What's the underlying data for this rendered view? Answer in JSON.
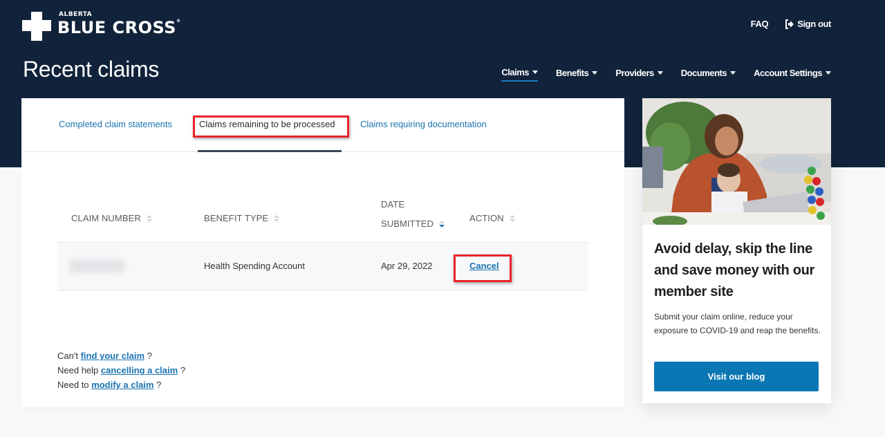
{
  "brand": {
    "name_small": "ALBERTA",
    "name_large": "BLUE CROSS",
    "trademark": "®"
  },
  "header": {
    "page_title": "Recent claims",
    "utility_nav": [
      {
        "label": "FAQ",
        "icon": null
      },
      {
        "label": "Sign out",
        "icon": "sign-out-icon"
      }
    ],
    "main_nav": [
      {
        "label": "Claims",
        "active": true
      },
      {
        "label": "Benefits",
        "active": false
      },
      {
        "label": "Providers",
        "active": false
      },
      {
        "label": "Documents",
        "active": false
      },
      {
        "label": "Account Settings",
        "active": false
      }
    ]
  },
  "tabs": [
    {
      "label": "Completed claim statements",
      "selected": false
    },
    {
      "label": "Claims remaining to be processed",
      "selected": true
    },
    {
      "label": "Claims requiring documentation",
      "selected": false
    }
  ],
  "table": {
    "columns": [
      {
        "label": "CLAIM NUMBER",
        "sort": "none"
      },
      {
        "label": "BENEFIT TYPE",
        "sort": "none"
      },
      {
        "label_line1": "DATE",
        "label_line2": "SUBMITTED",
        "sort": "descending"
      },
      {
        "label": "ACTION",
        "sort": "none"
      }
    ],
    "rows": [
      {
        "claim_number": "[redacted]",
        "benefit_type": "Health Spending Account",
        "date_submitted": "Apr 29, 2022",
        "action": "Cancel"
      }
    ]
  },
  "help_links": [
    {
      "prefix": "Can't",
      "link": "find your claim",
      "suffix": "?"
    },
    {
      "prefix": "Need help",
      "link": "cancelling a claim",
      "suffix": "?"
    },
    {
      "prefix": "Need to",
      "link": "modify a claim",
      "suffix": "?"
    }
  ],
  "promo": {
    "image_alt": "Mother with baby using laptop",
    "title": "Avoid delay, skip the line and save money with our member site",
    "body": "Submit your claim online, reduce your exposure to COVID-19 and reap the benefits.",
    "button_label": "Visit our blog"
  },
  "highlight_color": "#e8232a",
  "accent_color": "#0b76b4"
}
